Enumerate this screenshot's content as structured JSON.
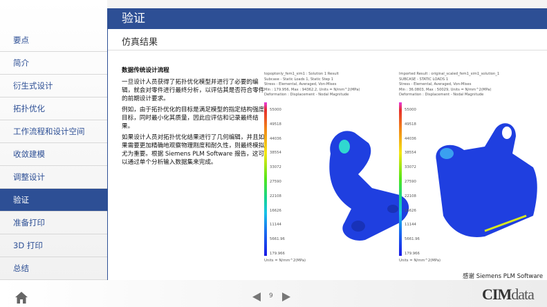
{
  "sidebar": {
    "items": [
      "要点",
      "简介",
      "衍生式设计",
      "拓扑优化",
      "工作流程和设计空间",
      "收敛建模",
      "调整设计",
      "验证",
      "准备打印",
      "3D 打印",
      "总结"
    ],
    "active_index": 7
  },
  "header": {
    "title": "验证",
    "subtitle": "仿真结果"
  },
  "body": {
    "heading": "数据传统设计流程",
    "paragraphs": [
      "一旦设计人员获得了拓扑优化模型并进行了必要的编辑，就会对零件进行最终分析，以评估其是否符合零件的前期设计要求。",
      "例如，由于拓扑优化的目标是满足模型的指定结构强度目标，同时最小化其质量，因此应评估和记录最终结果。",
      "如果设计人员对拓扑优化结果进行了几何编辑，并且如果需要更加精确地观察物理刚度和耐久性，则最终模拟尤为重要。根据 Siemens PLM Software 报告，这可以通过单个分析输入数据集来完成。"
    ]
  },
  "results": [
    {
      "lines": [
        "topoptonly_fem1_sim1 : Solution 1 Result",
        "Subcase - Static Loads 1, Static Step 1",
        "Stress - Elemental, Averaged, Von-Mises",
        "Min : 179.956, Max : 94362.2, Units = N/mm^2(MPa)",
        "Deformation : Displacement - Nodal Magnitude"
      ],
      "ticks": [
        "55000",
        "49518",
        "44036",
        "38554",
        "33072",
        "27590",
        "22108",
        "16626",
        "11144",
        "5661.96",
        "179.966"
      ],
      "units": "Units = N/mm^2(MPa)"
    },
    {
      "lines": [
        "Imported Result : original_scaled_fem1_sim1_solution_1",
        "SUBCASE - STATIC LOADS 1",
        "Stress - Elemental, Averaged, Von-Mises",
        "Min : 36.0803, Max : 50029, Units = N/mm^2(MPa)",
        "Deformation : Displacement - Nodal Magnitude"
      ],
      "ticks": [
        "55000",
        "49518",
        "44036",
        "38554",
        "33072",
        "27590",
        "22108",
        "16626",
        "11144",
        "5661.96",
        "179.966"
      ],
      "units": "Units = N/mm^2(MPa)"
    }
  ],
  "credit": "感谢 Siemens PLM Software 提供图片",
  "footer": {
    "page": "9",
    "logo": "CIMdata"
  },
  "colors": {
    "accent": "#2d4f95"
  }
}
